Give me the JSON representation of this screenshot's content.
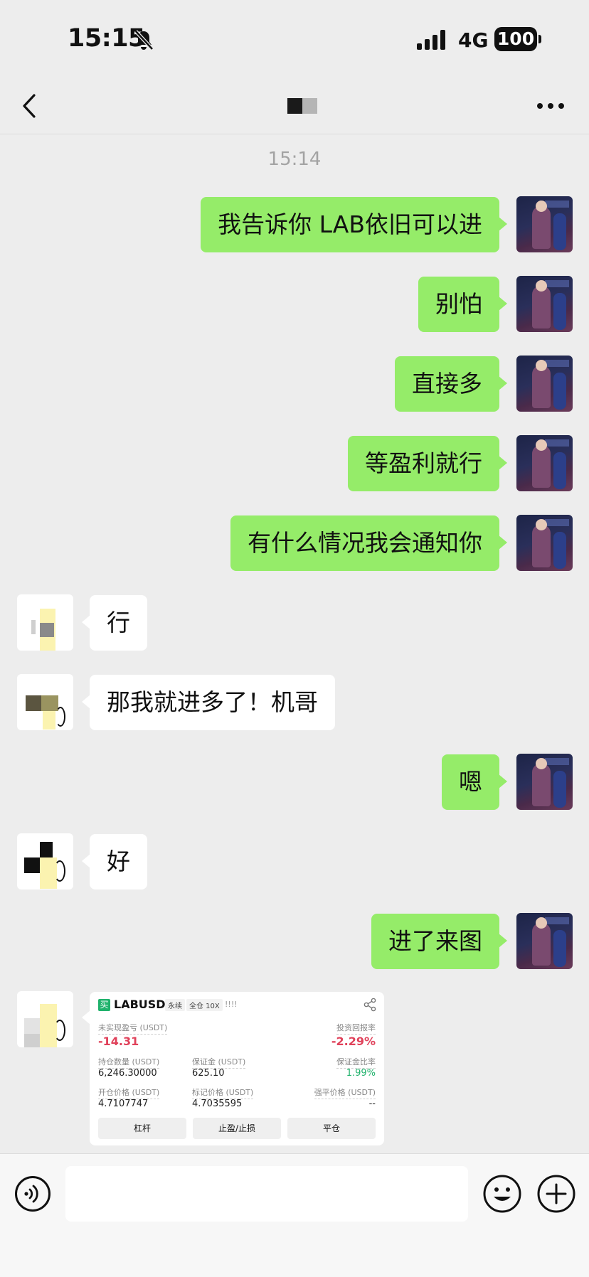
{
  "status_bar": {
    "time": "15:15",
    "network": "4G",
    "battery": "100"
  },
  "nav": {
    "back_icon": "chevron-left-icon",
    "more_icon": "more-dots-icon"
  },
  "chat": {
    "timestamp": "15:14",
    "messages": [
      {
        "from": "me",
        "text": "我告诉你 LAB依旧可以进"
      },
      {
        "from": "me",
        "text": "别怕"
      },
      {
        "from": "me",
        "text": "直接多"
      },
      {
        "from": "me",
        "text": "等盈利就行"
      },
      {
        "from": "me",
        "text": "有什么情况我会通知你"
      },
      {
        "from": "other",
        "text": "行"
      },
      {
        "from": "other",
        "text": "那我就进多了！机哥"
      },
      {
        "from": "me",
        "text": "嗯"
      },
      {
        "from": "other",
        "text": "好"
      },
      {
        "from": "me",
        "text": "进了来图"
      }
    ]
  },
  "trade_card": {
    "buy_badge": "买",
    "symbol": "LABUSDT",
    "tag_perpetual": "永续",
    "tag_margin": "全仓 10X",
    "bars": "!!!!",
    "unrealized_pnl_label": "未实现盈亏 (USDT)",
    "unrealized_pnl": "-14.31",
    "roi_label": "投资回报率",
    "roi": "-2.29%",
    "position_qty_label": "持仓数量 (USDT)",
    "position_qty": "6,246.30000",
    "margin_label": "保证金 (USDT)",
    "margin": "625.10",
    "margin_ratio_label": "保证金比率",
    "margin_ratio": "1.99%",
    "entry_price_label": "开仓价格 (USDT)",
    "entry_price": "4.7107747",
    "mark_price_label": "标记价格 (USDT)",
    "mark_price": "4.7035595",
    "liq_price_label": "强平价格 (USDT)",
    "liq_price": "--",
    "buttons": [
      "杠杆",
      "止盈/止损",
      "平仓"
    ]
  },
  "colors": {
    "my_bubble": "#95ec69",
    "other_bubble": "#ffffff",
    "background": "#ededed",
    "loss_red": "#e0415a",
    "gain_green": "#20b26c"
  }
}
